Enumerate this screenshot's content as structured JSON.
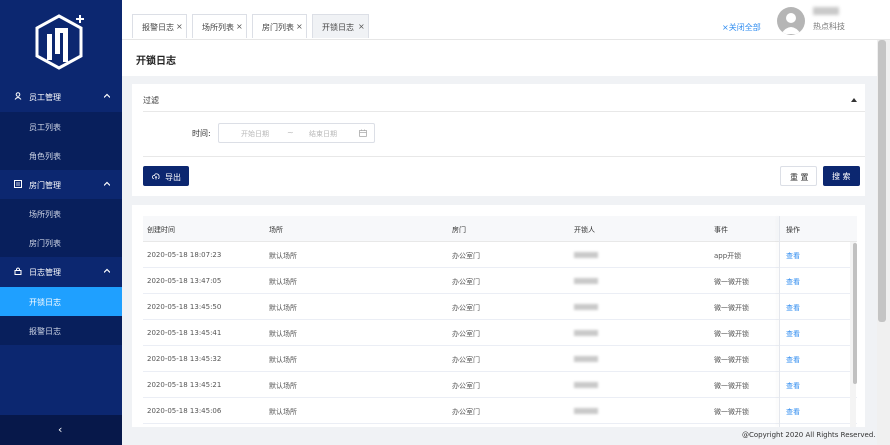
{
  "sidebar": {
    "groups": [
      {
        "label": "员工管理",
        "icon": "user-icon",
        "items": [
          "员工列表",
          "角色列表"
        ]
      },
      {
        "label": "房门管理",
        "icon": "list-icon",
        "items": [
          "场所列表",
          "房门列表"
        ]
      },
      {
        "label": "日志管理",
        "icon": "lock-icon",
        "items": [
          "开锁日志",
          "报警日志"
        ]
      }
    ],
    "active_item": "开锁日志",
    "collapse_label": "‹"
  },
  "header": {
    "tabs": [
      {
        "label": "报警日志",
        "close": "×"
      },
      {
        "label": "场所列表",
        "close": "×"
      },
      {
        "label": "房门列表",
        "close": "×"
      },
      {
        "label": "开锁日志",
        "close": "×"
      }
    ],
    "active_tab": "开锁日志",
    "close_all_label": "×关闭全部",
    "user": {
      "company": "热点科技"
    }
  },
  "page": {
    "title": "开锁日志"
  },
  "filter": {
    "title": "过滤",
    "time_label": "时间:",
    "start_placeholder": "开始日期",
    "separator": "~",
    "end_placeholder": "结束日期",
    "export_label": "导出",
    "reset_label": "重 置",
    "search_label": "搜 索"
  },
  "table": {
    "columns": [
      "创建时间",
      "场所",
      "房门",
      "开锁人",
      "事件",
      "操作"
    ],
    "rows": [
      {
        "time": "2020-05-18 18:07:23",
        "place": "默认场所",
        "door": "办公室门",
        "event": "app开锁",
        "action": "查看"
      },
      {
        "time": "2020-05-18 13:47:05",
        "place": "默认场所",
        "door": "办公室门",
        "event": "微一微开锁",
        "action": "查看"
      },
      {
        "time": "2020-05-18 13:45:50",
        "place": "默认场所",
        "door": "办公室门",
        "event": "微一微开锁",
        "action": "查看"
      },
      {
        "time": "2020-05-18 13:45:41",
        "place": "默认场所",
        "door": "办公室门",
        "event": "微一微开锁",
        "action": "查看"
      },
      {
        "time": "2020-05-18 13:45:32",
        "place": "默认场所",
        "door": "办公室门",
        "event": "微一微开锁",
        "action": "查看"
      },
      {
        "time": "2020-05-18 13:45:21",
        "place": "默认场所",
        "door": "办公室门",
        "event": "微一微开锁",
        "action": "查看"
      },
      {
        "time": "2020-05-18 13:45:06",
        "place": "默认场所",
        "door": "办公室门",
        "event": "微一微开锁",
        "action": "查看"
      }
    ]
  },
  "footer": {
    "copyright": "@Copyright 2020 All Rights Reserved."
  }
}
